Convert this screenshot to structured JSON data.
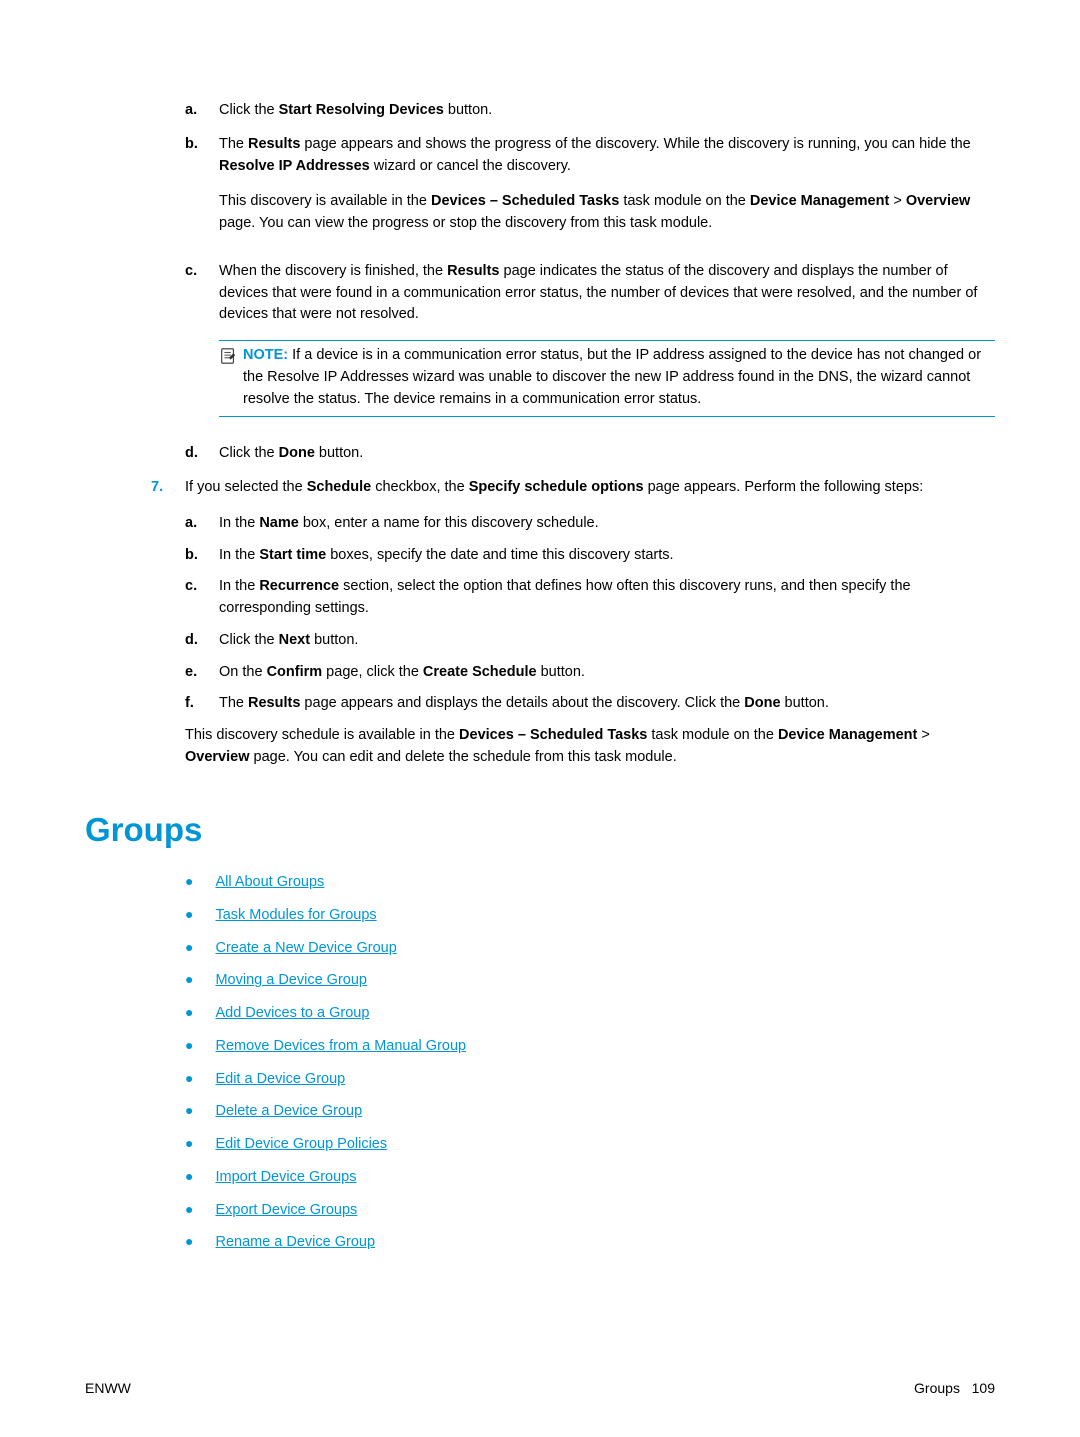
{
  "items6": {
    "a": {
      "prefix": "Click the ",
      "bold": "Start Resolving Devices",
      "suffix": " button."
    },
    "b": {
      "p1": {
        "t1": "The ",
        "b1": "Results",
        "t2": " page appears and shows the progress of the discovery. While the discovery is running, you can hide the ",
        "b2": "Resolve IP Addresses",
        "t3": " wizard or cancel the discovery."
      },
      "p2": {
        "t1": "This discovery is available in the ",
        "b1": "Devices – Scheduled Tasks",
        "t2": " task module on the ",
        "b2": "Device Management",
        "t3": " > ",
        "b3": "Overview",
        "t4": " page. You can view the progress or stop the discovery from this task module."
      }
    },
    "c": {
      "p1": {
        "t1": "When the discovery is finished, the ",
        "b1": "Results",
        "t2": " page indicates the status of the discovery and displays the number of devices that were found in a communication error status, the number of devices that were resolved, and the number of devices that were not resolved."
      },
      "note_label": "NOTE:",
      "note_text": "If a device is in a communication error status, but the IP address assigned to the device has not changed or the Resolve IP Addresses wizard was unable to discover the new IP address found in the DNS, the wizard cannot resolve the status. The device remains in a communication error status."
    },
    "d": {
      "prefix": "Click the ",
      "bold": "Done",
      "suffix": " button."
    }
  },
  "item7": {
    "label": "7.",
    "intro": {
      "t1": "If you selected the ",
      "b1": "Schedule",
      "t2": " checkbox, the ",
      "b2": "Specify schedule options",
      "t3": " page appears. Perform the following steps:"
    },
    "a": {
      "t1": "In the ",
      "b1": "Name",
      "t2": " box, enter a name for this discovery schedule."
    },
    "b": {
      "t1": "In the ",
      "b1": "Start time",
      "t2": " boxes, specify the date and time this discovery starts."
    },
    "c": {
      "t1": "In the ",
      "b1": "Recurrence",
      "t2": " section, select the option that defines how often this discovery runs, and then specify the corresponding settings."
    },
    "d": {
      "t1": "Click the ",
      "b1": "Next",
      "t2": " button."
    },
    "e": {
      "t1": "On the ",
      "b1": "Confirm",
      "t2": " page, click the ",
      "b2": "Create Schedule",
      "t3": " button."
    },
    "f": {
      "t1": "The ",
      "b1": "Results",
      "t2": " page appears and displays the details about the discovery. Click the ",
      "b2": "Done",
      "t3": " button."
    },
    "outro": {
      "t1": "This discovery schedule is available in the ",
      "b1": "Devices – Scheduled Tasks",
      "t2": " task module on the ",
      "b2": "Device Management",
      "t3": " > ",
      "b3": "Overview",
      "t4": " page. You can edit and delete the schedule from this task module."
    }
  },
  "heading": "Groups",
  "links": [
    "All About Groups",
    "Task Modules for Groups",
    "Create a New Device Group",
    "Moving a Device Group",
    "Add Devices to a Group",
    "Remove Devices from a Manual Group",
    "Edit a Device Group",
    "Delete a Device Group",
    "Edit Device Group Policies",
    "Import Device Groups",
    "Export Device Groups",
    "Rename a Device Group"
  ],
  "footer": {
    "left": "ENWW",
    "right_label": "Groups",
    "right_page": "109"
  },
  "labels": {
    "a": "a.",
    "b": "b.",
    "c": "c.",
    "d": "d.",
    "e": "e.",
    "f": "f."
  }
}
